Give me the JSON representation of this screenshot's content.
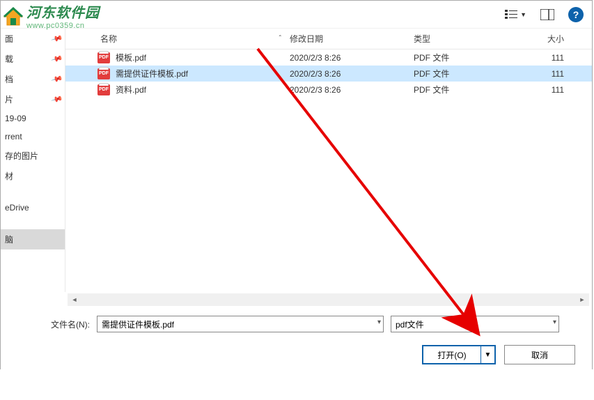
{
  "watermark": {
    "title": "河东软件园",
    "url": "www.pc0359.cn"
  },
  "toolbar": {
    "view_label": "视图",
    "help": "?"
  },
  "sidebar": {
    "items": [
      {
        "label": "面",
        "pinned": true
      },
      {
        "label": "载",
        "pinned": true
      },
      {
        "label": "档",
        "pinned": true
      },
      {
        "label": "片",
        "pinned": true
      },
      {
        "label": "19-09",
        "pinned": false
      },
      {
        "label": "rrent",
        "pinned": false
      },
      {
        "label": "存的图片",
        "pinned": false
      },
      {
        "label": "材",
        "pinned": false
      },
      {
        "label": "eDrive",
        "pinned": false
      },
      {
        "label": "脑",
        "pinned": false,
        "selected": true
      },
      {
        "label": "",
        "pinned": false
      }
    ]
  },
  "columns": {
    "name": "名称",
    "date": "修改日期",
    "type": "类型",
    "size": "大小"
  },
  "files": [
    {
      "name": "模板.pdf",
      "date": "2020/2/3 8:26",
      "type": "PDF 文件",
      "size": "111",
      "selected": false
    },
    {
      "name": "需提供证件模板.pdf",
      "date": "2020/2/3 8:26",
      "type": "PDF 文件",
      "size": "111",
      "selected": true
    },
    {
      "name": "资料.pdf",
      "date": "2020/2/3 8:26",
      "type": "PDF 文件",
      "size": "111",
      "selected": false
    }
  ],
  "filename": {
    "label": "文件名(N):",
    "value": "需提供证件模板.pdf"
  },
  "filetype": {
    "value": "pdf文件"
  },
  "buttons": {
    "open": "打开(O)",
    "cancel": "取消"
  }
}
